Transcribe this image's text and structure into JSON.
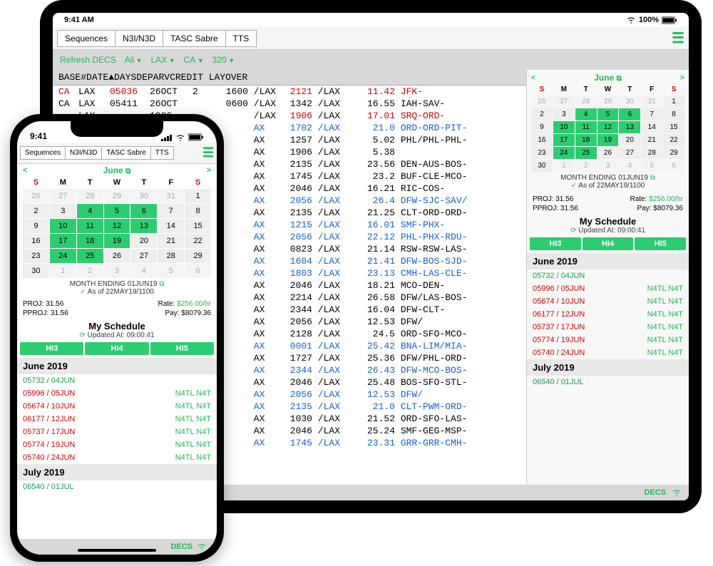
{
  "status": {
    "time_phone": "9:41",
    "time_tablet": "9:41 AM",
    "battery_pct": "100%"
  },
  "tabs": [
    "Sequences",
    "N3I/N3D",
    "TASC Sabre",
    "TTS"
  ],
  "filters": {
    "refresh": "Refresh DECS",
    "all": "All",
    "lax": "LAX",
    "ca": "CA",
    "num": "320"
  },
  "headers": {
    "base": "BASE",
    "num": "#",
    "date": "DATE▲",
    "days": "DAYS",
    "dep": "DEP",
    "arv": "ARV",
    "credit": "CREDIT",
    "layover": "LAYOVER"
  },
  "rows": [
    {
      "base": "CA",
      "lax": "LAX",
      "num": "05036",
      "date": "26OCT",
      "days": "2",
      "dep": "1600",
      "s1": "/LAX",
      "arv": "2121",
      "s2": "/LAX",
      "cred": "11.42",
      "lay": "JFK-",
      "color": "red"
    },
    {
      "base": "CA",
      "lax": "LAX",
      "num": "05411",
      "date": "26OCT",
      "days": "",
      "dep": "0600",
      "s1": "/LAX",
      "arv": "1342",
      "s2": "/LAX",
      "cred": "16.55",
      "lay": "IAH-SAV-",
      "color": "black"
    },
    {
      "base": "",
      "lax": "LAX",
      "num": "",
      "date": "1906",
      "days": "",
      "dep": "",
      "s1": "/LAX",
      "arv": "1906",
      "s2": "/LAX",
      "cred": "17.01",
      "lay": "SRQ-ORD-",
      "color": "red"
    },
    {
      "base": "",
      "lax": "",
      "num": "",
      "date": "",
      "days": "",
      "dep": "",
      "s1": "AX",
      "arv": "1702",
      "s2": "/LAX",
      "cred": "21.0",
      "lay": "ORD-ORD-PIT-",
      "color": "blue"
    },
    {
      "base": "",
      "lax": "",
      "num": "",
      "date": "",
      "days": "",
      "dep": "",
      "s1": "AX",
      "arv": "1257",
      "s2": "/LAX",
      "cred": "5.02",
      "lay": "PHL/PHL-PHL-",
      "color": "black"
    },
    {
      "base": "",
      "lax": "",
      "num": "",
      "date": "",
      "days": "",
      "dep": "",
      "s1": "AX",
      "arv": "1906",
      "s2": "/LAX",
      "cred": "5.38",
      "lay": "",
      "color": "black"
    },
    {
      "base": "",
      "lax": "",
      "num": "",
      "date": "",
      "days": "",
      "dep": "",
      "s1": "AX",
      "arv": "2135",
      "s2": "/LAX",
      "cred": "23.56",
      "lay": "DEN-AUS-BOS-",
      "color": "black"
    },
    {
      "base": "",
      "lax": "",
      "num": "",
      "date": "",
      "days": "",
      "dep": "",
      "s1": "AX",
      "arv": "1745",
      "s2": "/LAX",
      "cred": "23.2",
      "lay": "BUF-CLE-MCO-",
      "color": "black"
    },
    {
      "base": "",
      "lax": "",
      "num": "",
      "date": "",
      "days": "",
      "dep": "",
      "s1": "AX",
      "arv": "2046",
      "s2": "/LAX",
      "cred": "16.21",
      "lay": "RIC-COS-",
      "color": "black"
    },
    {
      "base": "",
      "lax": "",
      "num": "",
      "date": "",
      "days": "",
      "dep": "",
      "s1": "AX",
      "arv": "2056",
      "s2": "/LAX",
      "cred": "26.4",
      "lay": "DFW-SJC-SAV/",
      "color": "blue"
    },
    {
      "base": "",
      "lax": "",
      "num": "",
      "date": "",
      "days": "",
      "dep": "",
      "s1": "AX",
      "arv": "2135",
      "s2": "/LAX",
      "cred": "21.25",
      "lay": "CLT-ORD-ORD-",
      "color": "black"
    },
    {
      "base": "",
      "lax": "",
      "num": "",
      "date": "",
      "days": "",
      "dep": "",
      "s1": "AX",
      "arv": "1215",
      "s2": "/LAX",
      "cred": "16.01",
      "lay": "SMF-PHX-",
      "color": "blue"
    },
    {
      "base": "",
      "lax": "",
      "num": "",
      "date": "",
      "days": "",
      "dep": "",
      "s1": "AX",
      "arv": "2056",
      "s2": "/LAX",
      "cred": "22.12",
      "lay": "PHL-PHX-RDU-",
      "color": "blue"
    },
    {
      "base": "",
      "lax": "",
      "num": "",
      "date": "",
      "days": "",
      "dep": "",
      "s1": "AX",
      "arv": "0823",
      "s2": "/LAX",
      "cred": "21.14",
      "lay": "RSW-RSW-LAS-",
      "color": "black"
    },
    {
      "base": "",
      "lax": "",
      "num": "",
      "date": "",
      "days": "",
      "dep": "",
      "s1": "AX",
      "arv": "1604",
      "s2": "/LAX",
      "cred": "21.41",
      "lay": "DFW-BOS-SJD-",
      "color": "blue"
    },
    {
      "base": "",
      "lax": "",
      "num": "",
      "date": "",
      "days": "",
      "dep": "",
      "s1": "AX",
      "arv": "1803",
      "s2": "/LAX",
      "cred": "23.13",
      "lay": "CMH-LAS-CLE-",
      "color": "blue"
    },
    {
      "base": "",
      "lax": "",
      "num": "",
      "date": "",
      "days": "",
      "dep": "",
      "s1": "AX",
      "arv": "2046",
      "s2": "/LAX",
      "cred": "18.21",
      "lay": "MCO-DEN-",
      "color": "black"
    },
    {
      "base": "",
      "lax": "",
      "num": "",
      "date": "",
      "days": "",
      "dep": "",
      "s1": "AX",
      "arv": "2214",
      "s2": "/LAX",
      "cred": "26.58",
      "lay": "DFW/LAS-BOS-",
      "color": "black"
    },
    {
      "base": "",
      "lax": "",
      "num": "",
      "date": "",
      "days": "",
      "dep": "",
      "s1": "AX",
      "arv": "2344",
      "s2": "/LAX",
      "cred": "16.04",
      "lay": "DFW-CLT-",
      "color": "black"
    },
    {
      "base": "",
      "lax": "",
      "num": "",
      "date": "",
      "days": "",
      "dep": "",
      "s1": "AX",
      "arv": "2056",
      "s2": "/LAX",
      "cred": "12.53",
      "lay": "DFW/",
      "color": "black"
    },
    {
      "base": "",
      "lax": "",
      "num": "",
      "date": "",
      "days": "",
      "dep": "",
      "s1": "AX",
      "arv": "2128",
      "s2": "/LAX",
      "cred": "24.5",
      "lay": "ORD-SFO-MCO-",
      "color": "black"
    },
    {
      "base": "",
      "lax": "",
      "num": "",
      "date": "",
      "days": "",
      "dep": "",
      "s1": "AX",
      "arv": "0001",
      "s2": "/LAX",
      "cred": "25.42",
      "lay": "BNA-LIM/MIA-",
      "color": "blue"
    },
    {
      "base": "",
      "lax": "",
      "num": "",
      "date": "",
      "days": "",
      "dep": "",
      "s1": "AX",
      "arv": "1727",
      "s2": "/LAX",
      "cred": "25.36",
      "lay": "DFW/PHL-ORD-",
      "color": "black"
    },
    {
      "base": "",
      "lax": "",
      "num": "",
      "date": "",
      "days": "",
      "dep": "",
      "s1": "AX",
      "arv": "2344",
      "s2": "/LAX",
      "cred": "26.43",
      "lay": "DFW-MCO-BOS-",
      "color": "blue"
    },
    {
      "base": "",
      "lax": "",
      "num": "",
      "date": "",
      "days": "",
      "dep": "",
      "s1": "AX",
      "arv": "2046",
      "s2": "/LAX",
      "cred": "25.48",
      "lay": "BOS-SFO-STL-",
      "color": "black"
    },
    {
      "base": "",
      "lax": "",
      "num": "",
      "date": "",
      "days": "",
      "dep": "",
      "s1": "AX",
      "arv": "2056",
      "s2": "/LAX",
      "cred": "12.53",
      "lay": "DFW/",
      "color": "blue"
    },
    {
      "base": "",
      "lax": "",
      "num": "",
      "date": "",
      "days": "",
      "dep": "",
      "s1": "AX",
      "arv": "2135",
      "s2": "/LAX",
      "cred": "21.0",
      "lay": "CLT-PWM-ORD-",
      "color": "blue"
    },
    {
      "base": "",
      "lax": "",
      "num": "",
      "date": "",
      "days": "",
      "dep": "",
      "s1": "AX",
      "arv": "1030",
      "s2": "/LAX",
      "cred": "21.52",
      "lay": "ORD-SFO-LAS-",
      "color": "black"
    },
    {
      "base": "",
      "lax": "",
      "num": "",
      "date": "",
      "days": "",
      "dep": "",
      "s1": "AX",
      "arv": "2046",
      "s2": "/LAX",
      "cred": "25.24",
      "lay": "SMF-GEG-MSP-",
      "color": "black"
    },
    {
      "base": "",
      "lax": "",
      "num": "",
      "date": "",
      "days": "",
      "dep": "",
      "s1": "AX",
      "arv": "1745",
      "s2": "/LAX",
      "cred": "23.31",
      "lay": "GRR-GRR-CMH-",
      "color": "blue"
    }
  ],
  "calendar": {
    "month": "June",
    "dows": [
      "S",
      "M",
      "T",
      "W",
      "T",
      "F",
      "S"
    ],
    "weeks": [
      [
        {
          "d": "26",
          "dim": true
        },
        {
          "d": "27",
          "dim": true
        },
        {
          "d": "28",
          "dim": true
        },
        {
          "d": "29",
          "dim": true
        },
        {
          "d": "30",
          "dim": true
        },
        {
          "d": "31",
          "dim": true
        },
        {
          "d": "1"
        }
      ],
      [
        {
          "d": "2"
        },
        {
          "d": "3"
        },
        {
          "d": "4",
          "hl": true
        },
        {
          "d": "5",
          "hl": true
        },
        {
          "d": "6",
          "hl": true
        },
        {
          "d": "7"
        },
        {
          "d": "8"
        }
      ],
      [
        {
          "d": "9"
        },
        {
          "d": "10",
          "hl": true
        },
        {
          "d": "11",
          "hl": true
        },
        {
          "d": "12",
          "hl": true
        },
        {
          "d": "13",
          "hl": true
        },
        {
          "d": "14"
        },
        {
          "d": "15"
        }
      ],
      [
        {
          "d": "16"
        },
        {
          "d": "17",
          "hl": true
        },
        {
          "d": "18",
          "hl": true
        },
        {
          "d": "19",
          "hl": true
        },
        {
          "d": "20"
        },
        {
          "d": "21"
        },
        {
          "d": "22"
        }
      ],
      [
        {
          "d": "23"
        },
        {
          "d": "24",
          "hl": true
        },
        {
          "d": "25",
          "hl": true
        },
        {
          "d": "26"
        },
        {
          "d": "27"
        },
        {
          "d": "28"
        },
        {
          "d": "29"
        }
      ],
      [
        {
          "d": "30"
        },
        {
          "d": "1",
          "dim": true
        },
        {
          "d": "2",
          "dim": true
        },
        {
          "d": "3",
          "dim": true
        },
        {
          "d": "4",
          "dim": true
        },
        {
          "d": "5",
          "dim": true
        },
        {
          "d": "6",
          "dim": true
        }
      ]
    ],
    "monthend": "MONTH ENDING 01JUN19",
    "asof": "As of 22MAY19/1100"
  },
  "proj": {
    "proj_lbl": "PROJ:",
    "proj_val": "31.56",
    "rate_lbl": "Rate:",
    "rate_val": "$256.00/hr",
    "pproj_lbl": "PPROJ:",
    "pproj_val": "31.56",
    "pay_lbl": "Pay:",
    "pay_val": "$8079.36"
  },
  "mysched": {
    "title": "My Schedule",
    "updated": "Updated At: 09:00:41"
  },
  "hi": [
    "HI3",
    "HI4",
    "HI5"
  ],
  "months": {
    "june": "June 2019",
    "july": "July 2019"
  },
  "sched": [
    {
      "id": "05732",
      "date": "04JUN",
      "cls": "sgreen",
      "right": ""
    },
    {
      "id": "05996",
      "date": "05JUN",
      "cls": "sred",
      "right": "N4TL N4T"
    },
    {
      "id": "05674",
      "date": "10JUN",
      "cls": "sred",
      "right": "N4TL N4T"
    },
    {
      "id": "06177",
      "date": "12JUN",
      "cls": "sred",
      "right": "N4TL N4T"
    },
    {
      "id": "05737",
      "date": "17JUN",
      "cls": "sred",
      "right": "N4TL N4T"
    },
    {
      "id": "05774",
      "date": "19JUN",
      "cls": "sred",
      "right": "N4TL N4T"
    },
    {
      "id": "05740",
      "date": "24JUN",
      "cls": "sred",
      "right": "N4TL N4T"
    }
  ],
  "sched_july": [
    {
      "id": "06540",
      "date": "01JUL",
      "cls": "sgreen",
      "right": ""
    }
  ],
  "decs": "DECS"
}
